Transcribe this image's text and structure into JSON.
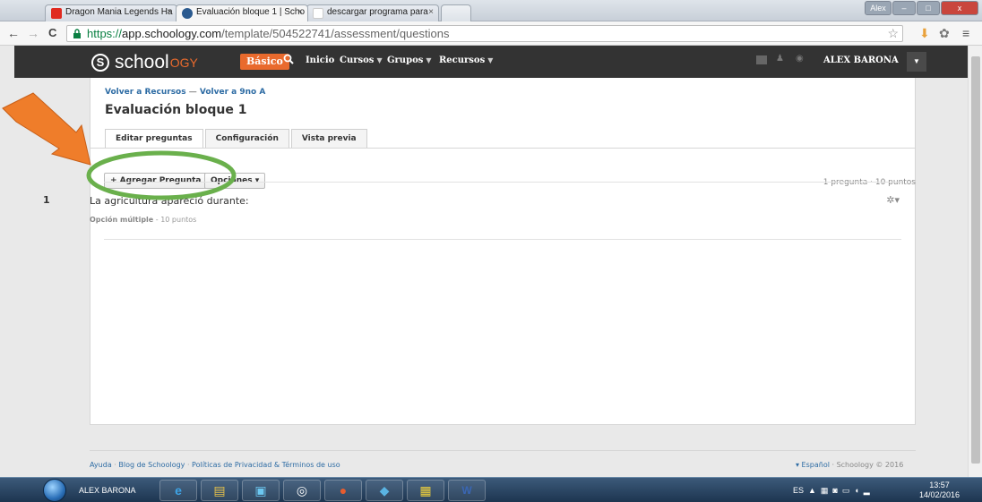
{
  "browser": {
    "tabs": [
      {
        "title": "Dragon Mania Legends Ha",
        "close": "×"
      },
      {
        "title": "Evaluación bloque 1 | Scho",
        "close": "×"
      },
      {
        "title": "descargar programa para",
        "close": "×"
      }
    ],
    "window_buttons": {
      "alt_label": "Alex",
      "minimize": "–",
      "maximize": "□",
      "close": "x"
    },
    "nav": {
      "back": "←",
      "forward": "→",
      "reload": "C"
    },
    "url_scheme": "https://",
    "url_host": "app.schoology.com",
    "url_path": "/template/504522741/assessment/questions"
  },
  "header": {
    "logo_main": "school",
    "logo_accent": "OGY",
    "logo_mark": "S",
    "basic_badge": "Básico",
    "nav": [
      {
        "label": "Inicio",
        "caret": false
      },
      {
        "label": "Cursos",
        "caret": true
      },
      {
        "label": "Grupos",
        "caret": true
      },
      {
        "label": "Recursos",
        "caret": true
      }
    ],
    "user_name": "ALEX BARONA"
  },
  "page": {
    "breadcrumb_1": "Volver a Recursos",
    "breadcrumb_sep": "—",
    "breadcrumb_2": "Volver a 9no A",
    "title": "Evaluación bloque 1",
    "tabs": [
      "Editar preguntas",
      "Configuración",
      "Vista previa"
    ],
    "add_question_button": "+ Agregar Pregunta",
    "options_button": "Opciones ▾",
    "summary": "1 pregunta · 10 puntos",
    "question": {
      "number": "1",
      "text": "La agricultura apareció durante:",
      "type": "Opción múltiple",
      "points": " - 10 puntos"
    }
  },
  "footer": {
    "links": [
      "Ayuda",
      "Blog de Schoology",
      "Políticas de Privacidad & Términos de uso"
    ],
    "language": "▾ Español",
    "copyright": " · Schoology © 2016"
  },
  "taskbar": {
    "user": "ALEX BARONA",
    "tray_lang": "ES",
    "time": "13:57",
    "date": "14/02/2016"
  },
  "colors": {
    "brand_orange": "#e96a2d",
    "link_blue": "#2e6ca4",
    "annotation_green": "#6ab04c",
    "annotation_arrow": "#ef7d2a"
  }
}
